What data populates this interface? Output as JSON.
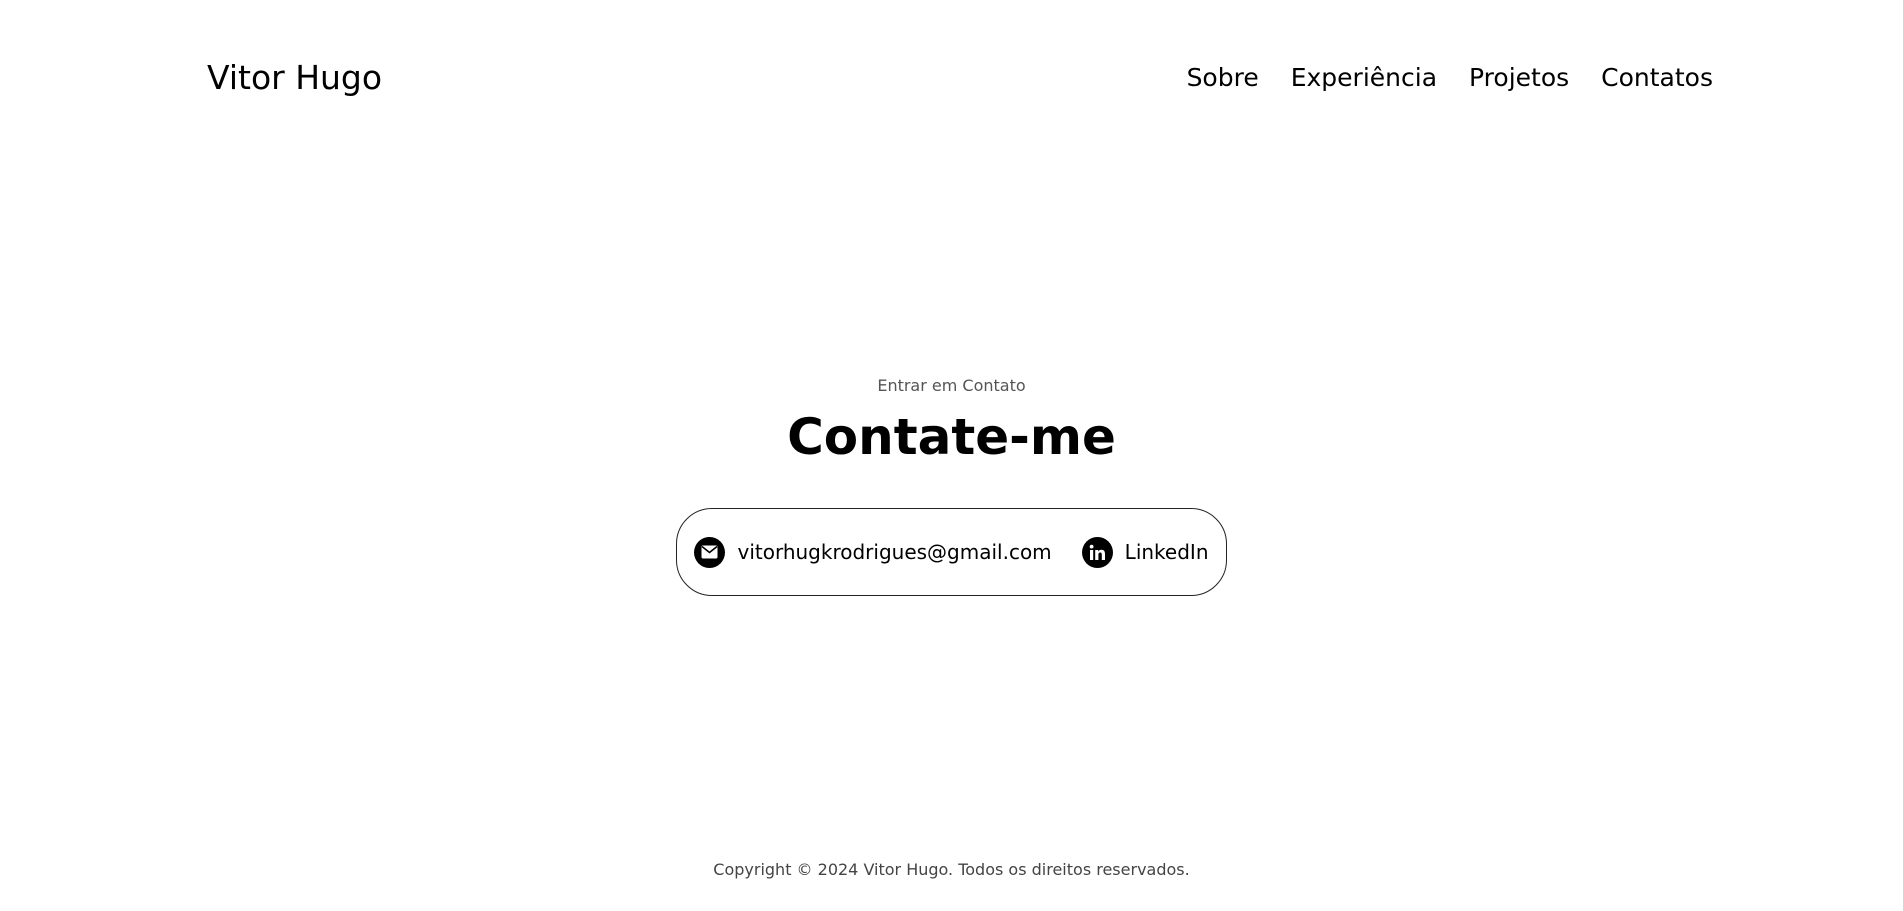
{
  "header": {
    "logo": "Vitor Hugo",
    "nav": [
      {
        "label": "Sobre"
      },
      {
        "label": "Experiência"
      },
      {
        "label": "Projetos"
      },
      {
        "label": "Contatos"
      }
    ]
  },
  "contact": {
    "subtitle": "Entrar em Contato",
    "title": "Contate-me",
    "email": {
      "label": "vitorhugkrodrigues@gmail.com",
      "icon": "email-icon"
    },
    "linkedin": {
      "label": "LinkedIn",
      "icon": "linkedin-icon"
    }
  },
  "footer": {
    "copyright": "Copyright © 2024 Vitor Hugo. Todos os direitos reservados."
  },
  "colors": {
    "background": "#ffffff",
    "text": "#000000",
    "muted": "#555555"
  }
}
